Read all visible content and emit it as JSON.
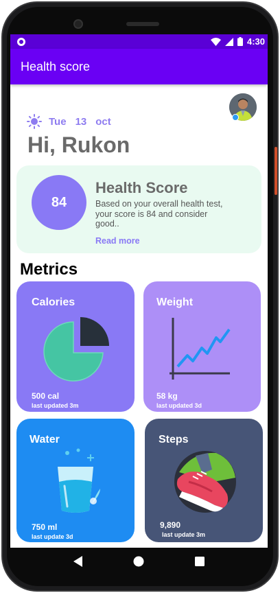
{
  "status_bar": {
    "time": "4:30"
  },
  "app_bar": {
    "title": "Health score"
  },
  "date": {
    "day": "Tue",
    "date": "13",
    "month": "oct"
  },
  "greeting": "Hi, Rukon",
  "score_card": {
    "score": "84",
    "title": "Health Score",
    "description": "Based on your overall health test, your score is 84 and consider good..",
    "read_more": "Read more"
  },
  "metrics": {
    "title": "Metrics",
    "tiles": [
      {
        "title": "Calories",
        "value": "500 cal",
        "updated": "last updated 3m",
        "color": "#8979f5",
        "icon": "pie-chart-icon"
      },
      {
        "title": "Weight",
        "value": "58 kg",
        "updated": "last updated 3d",
        "color": "#ad8ff7",
        "icon": "line-chart-icon"
      },
      {
        "title": "Water",
        "value": "750 ml",
        "updated": "last update 3d",
        "color": "#1e8cf2",
        "icon": "water-glass-icon"
      },
      {
        "title": "Steps",
        "value": "9,890",
        "updated": "last update 3m",
        "color": "#475577",
        "icon": "sneaker-icon"
      }
    ]
  },
  "colors": {
    "primary": "#6a00f4",
    "primary_dark": "#5a00d6",
    "accent": "#8979f5",
    "card_bg": "#e9faf1"
  }
}
